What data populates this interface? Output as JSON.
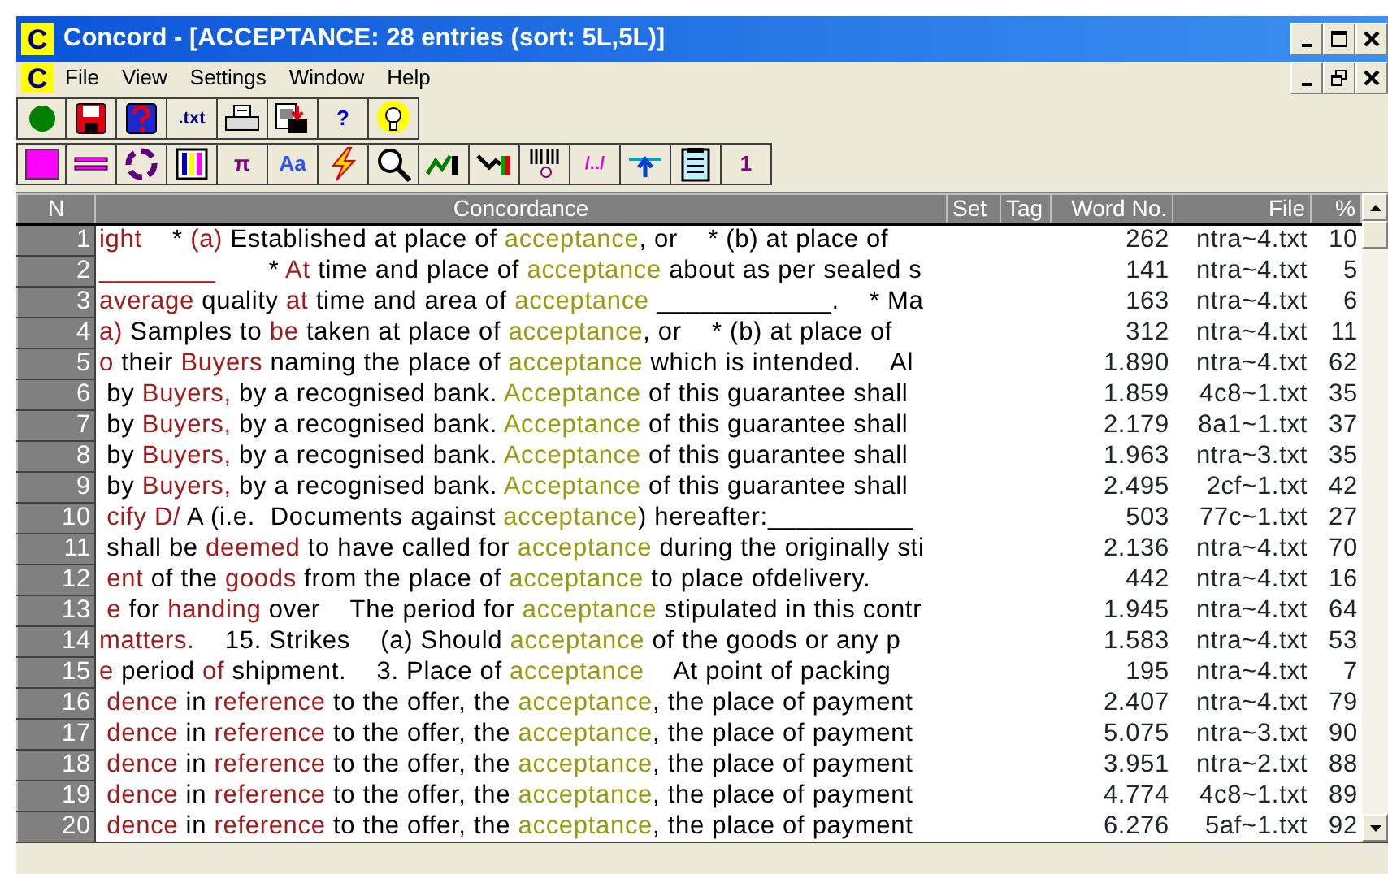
{
  "window": {
    "icon_letter": "C",
    "title": "Concord - [ACCEPTANCE: 28 entries (sort: 5L,5L)]"
  },
  "menu": {
    "icon_letter": "C",
    "items": [
      "File",
      "View",
      "Settings",
      "Window",
      "Help"
    ]
  },
  "toolbar_1": [
    {
      "kind": "green-dot"
    },
    {
      "kind": "floppy"
    },
    {
      "kind": "help-book"
    },
    {
      "kind": "glyph",
      "label": ".txt",
      "color": "#000080"
    },
    {
      "kind": "printer"
    },
    {
      "kind": "export"
    },
    {
      "kind": "glyph",
      "label": "?",
      "color": "#0000e0"
    },
    {
      "kind": "bulb"
    }
  ],
  "toolbar_2": [
    {
      "kind": "pink-square"
    },
    {
      "kind": "double-line"
    },
    {
      "kind": "cycle"
    },
    {
      "kind": "columns"
    },
    {
      "kind": "glyph",
      "label": "π",
      "color": "#800080"
    },
    {
      "kind": "glyph",
      "label": "Aa",
      "color": "#3050ff"
    },
    {
      "kind": "bolt"
    },
    {
      "kind": "magnifier"
    },
    {
      "kind": "plot"
    },
    {
      "kind": "plot2"
    },
    {
      "kind": "barcode"
    },
    {
      "kind": "glyph",
      "label": "/../",
      "color": "#e000e0"
    },
    {
      "kind": "up-arrow"
    },
    {
      "kind": "notepad"
    },
    {
      "kind": "glyph",
      "label": "1",
      "color": "#800080"
    }
  ],
  "table": {
    "columns": [
      "N",
      "Concordance",
      "Set",
      "Tag",
      "Word No.",
      "File",
      "%"
    ],
    "rows": [
      {
        "n": "1",
        "line": [
          {
            "kind": "collocate",
            "text": "ight"
          },
          {
            "kind": "plain",
            "text": "    * "
          },
          {
            "kind": "collocate",
            "text": "(a)"
          },
          {
            "kind": "plain",
            "text": " Established at place of "
          },
          {
            "kind": "node",
            "text": "acceptance"
          },
          {
            "kind": "plain",
            "text": ", or    * (b) at place of"
          }
        ],
        "word_no": "262",
        "file": "ntra~4.txt",
        "pct": "10"
      },
      {
        "n": "2",
        "line": [
          {
            "kind": "collocate",
            "text": "________"
          },
          {
            "kind": "plain",
            "text": "       * "
          },
          {
            "kind": "collocate",
            "text": "At"
          },
          {
            "kind": "plain",
            "text": " time and place of "
          },
          {
            "kind": "node",
            "text": "acceptance"
          },
          {
            "kind": "plain",
            "text": " about as per sealed s"
          }
        ],
        "word_no": "141",
        "file": "ntra~4.txt",
        "pct": "5"
      },
      {
        "n": "3",
        "line": [
          {
            "kind": "collocate",
            "text": "average"
          },
          {
            "kind": "plain",
            "text": " quality "
          },
          {
            "kind": "collocate",
            "text": "at"
          },
          {
            "kind": "plain",
            "text": " time and area of "
          },
          {
            "kind": "node",
            "text": "acceptance"
          },
          {
            "kind": "plain",
            "text": " ____________.    * Ma"
          }
        ],
        "word_no": "163",
        "file": "ntra~4.txt",
        "pct": "6"
      },
      {
        "n": "4",
        "line": [
          {
            "kind": "collocate",
            "text": "a)"
          },
          {
            "kind": "plain",
            "text": " Samples to "
          },
          {
            "kind": "collocate",
            "text": "be"
          },
          {
            "kind": "plain",
            "text": " taken at place of "
          },
          {
            "kind": "node",
            "text": "acceptance"
          },
          {
            "kind": "plain",
            "text": ", or    * (b) at place of"
          }
        ],
        "word_no": "312",
        "file": "ntra~4.txt",
        "pct": "11"
      },
      {
        "n": "5",
        "line": [
          {
            "kind": "collocate",
            "text": "o"
          },
          {
            "kind": "plain",
            "text": " their "
          },
          {
            "kind": "collocate",
            "text": "Buyers"
          },
          {
            "kind": "plain",
            "text": " naming the place of "
          },
          {
            "kind": "node",
            "text": "acceptance"
          },
          {
            "kind": "plain",
            "text": " which is intended.    Al"
          }
        ],
        "word_no": "1.890",
        "file": "ntra~4.txt",
        "pct": "62"
      },
      {
        "n": "6",
        "line": [
          {
            "kind": "plain",
            "text": " by "
          },
          {
            "kind": "collocate",
            "text": "Buyers,"
          },
          {
            "kind": "plain",
            "text": " by a recognised bank. "
          },
          {
            "kind": "node",
            "text": "Acceptance"
          },
          {
            "kind": "plain",
            "text": " of this guarantee shall"
          }
        ],
        "word_no": "1.859",
        "file": "4c8~1.txt",
        "pct": "35"
      },
      {
        "n": "7",
        "line": [
          {
            "kind": "plain",
            "text": " by "
          },
          {
            "kind": "collocate",
            "text": "Buyers,"
          },
          {
            "kind": "plain",
            "text": " by a recognised bank. "
          },
          {
            "kind": "node",
            "text": "Acceptance"
          },
          {
            "kind": "plain",
            "text": " of this guarantee shall"
          }
        ],
        "word_no": "2.179",
        "file": "8a1~1.txt",
        "pct": "37"
      },
      {
        "n": "8",
        "line": [
          {
            "kind": "plain",
            "text": " by "
          },
          {
            "kind": "collocate",
            "text": "Buyers,"
          },
          {
            "kind": "plain",
            "text": " by a recognised bank. "
          },
          {
            "kind": "node",
            "text": "Acceptance"
          },
          {
            "kind": "plain",
            "text": " of this guarantee shall"
          }
        ],
        "word_no": "1.963",
        "file": "ntra~3.txt",
        "pct": "35"
      },
      {
        "n": "9",
        "line": [
          {
            "kind": "plain",
            "text": " by "
          },
          {
            "kind": "collocate",
            "text": "Buyers,"
          },
          {
            "kind": "plain",
            "text": " by a recognised bank. "
          },
          {
            "kind": "node",
            "text": "Acceptance"
          },
          {
            "kind": "plain",
            "text": " of this guarantee shall"
          }
        ],
        "word_no": "2.495",
        "file": "2cf~1.txt",
        "pct": "42"
      },
      {
        "n": "10",
        "line": [
          {
            "kind": "collocate",
            "text": " cify D/"
          },
          {
            "kind": "plain",
            "text": " A (i.e.  Documents against "
          },
          {
            "kind": "node",
            "text": "acceptance"
          },
          {
            "kind": "plain",
            "text": ") hereafter:__________"
          }
        ],
        "word_no": "503",
        "file": "77c~1.txt",
        "pct": "27"
      },
      {
        "n": "11",
        "line": [
          {
            "kind": "plain",
            "text": " shall be "
          },
          {
            "kind": "collocate",
            "text": "deemed"
          },
          {
            "kind": "plain",
            "text": " to have called for "
          },
          {
            "kind": "node",
            "text": "acceptance"
          },
          {
            "kind": "plain",
            "text": " during the originally sti"
          }
        ],
        "word_no": "2.136",
        "file": "ntra~4.txt",
        "pct": "70"
      },
      {
        "n": "12",
        "line": [
          {
            "kind": "collocate",
            "text": " ent"
          },
          {
            "kind": "plain",
            "text": " of the "
          },
          {
            "kind": "collocate",
            "text": "goods"
          },
          {
            "kind": "plain",
            "text": " from the place of "
          },
          {
            "kind": "node",
            "text": "acceptance"
          },
          {
            "kind": "plain",
            "text": " to place ofdelivery."
          }
        ],
        "word_no": "442",
        "file": "ntra~4.txt",
        "pct": "16"
      },
      {
        "n": "13",
        "line": [
          {
            "kind": "collocate",
            "text": " e"
          },
          {
            "kind": "plain",
            "text": " for "
          },
          {
            "kind": "collocate",
            "text": "handing"
          },
          {
            "kind": "plain",
            "text": " over    The period for "
          },
          {
            "kind": "node",
            "text": "acceptance"
          },
          {
            "kind": "plain",
            "text": " stipulated in this contr"
          }
        ],
        "word_no": "1.945",
        "file": "ntra~4.txt",
        "pct": "64"
      },
      {
        "n": "14",
        "line": [
          {
            "kind": "collocate",
            "text": "matters."
          },
          {
            "kind": "plain",
            "text": "    15. Strikes    (a) Should "
          },
          {
            "kind": "node",
            "text": "acceptance"
          },
          {
            "kind": "plain",
            "text": " of the goods or any p"
          }
        ],
        "word_no": "1.583",
        "file": "ntra~4.txt",
        "pct": "53"
      },
      {
        "n": "15",
        "line": [
          {
            "kind": "collocate",
            "text": "e"
          },
          {
            "kind": "plain",
            "text": " period "
          },
          {
            "kind": "collocate",
            "text": "of"
          },
          {
            "kind": "plain",
            "text": " shipment.    3. Place of "
          },
          {
            "kind": "node",
            "text": "acceptance"
          },
          {
            "kind": "plain",
            "text": "    At point of packing"
          }
        ],
        "word_no": "195",
        "file": "ntra~4.txt",
        "pct": "7"
      },
      {
        "n": "16",
        "line": [
          {
            "kind": "collocate",
            "text": " dence"
          },
          {
            "kind": "plain",
            "text": " in "
          },
          {
            "kind": "collocate",
            "text": "reference"
          },
          {
            "kind": "plain",
            "text": " to the offer, the "
          },
          {
            "kind": "node",
            "text": "acceptance"
          },
          {
            "kind": "plain",
            "text": ", the place of payment"
          }
        ],
        "word_no": "2.407",
        "file": "ntra~4.txt",
        "pct": "79"
      },
      {
        "n": "17",
        "line": [
          {
            "kind": "collocate",
            "text": " dence"
          },
          {
            "kind": "plain",
            "text": " in "
          },
          {
            "kind": "collocate",
            "text": "reference"
          },
          {
            "kind": "plain",
            "text": " to the offer, the "
          },
          {
            "kind": "node",
            "text": "acceptance"
          },
          {
            "kind": "plain",
            "text": ", the place of payment"
          }
        ],
        "word_no": "5.075",
        "file": "ntra~3.txt",
        "pct": "90"
      },
      {
        "n": "18",
        "line": [
          {
            "kind": "collocate",
            "text": " dence"
          },
          {
            "kind": "plain",
            "text": " in "
          },
          {
            "kind": "collocate",
            "text": "reference"
          },
          {
            "kind": "plain",
            "text": " to the offer, the "
          },
          {
            "kind": "node",
            "text": "acceptance"
          },
          {
            "kind": "plain",
            "text": ", the place of payment"
          }
        ],
        "word_no": "3.951",
        "file": "ntra~2.txt",
        "pct": "88"
      },
      {
        "n": "19",
        "line": [
          {
            "kind": "collocate",
            "text": " dence"
          },
          {
            "kind": "plain",
            "text": " in "
          },
          {
            "kind": "collocate",
            "text": "reference"
          },
          {
            "kind": "plain",
            "text": " to the offer, the "
          },
          {
            "kind": "node",
            "text": "acceptance"
          },
          {
            "kind": "plain",
            "text": ", the place of payment"
          }
        ],
        "word_no": "4.774",
        "file": "4c8~1.txt",
        "pct": "89"
      },
      {
        "n": "20",
        "line": [
          {
            "kind": "collocate",
            "text": " dence"
          },
          {
            "kind": "plain",
            "text": " in "
          },
          {
            "kind": "collocate",
            "text": "reference"
          },
          {
            "kind": "plain",
            "text": " to the offer, the "
          },
          {
            "kind": "node",
            "text": "acceptance"
          },
          {
            "kind": "plain",
            "text": ", the place of payment"
          }
        ],
        "word_no": "6.276",
        "file": "5af~1.txt",
        "pct": "92"
      }
    ]
  }
}
